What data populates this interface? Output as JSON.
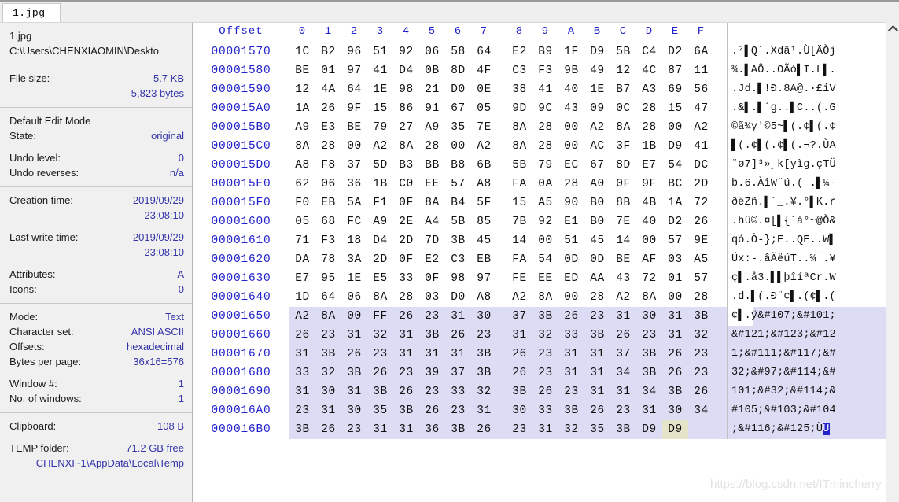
{
  "tab": {
    "label": "1.jpg"
  },
  "sidebar": {
    "file": {
      "name": "1.jpg",
      "path": "C:\\Users\\CHENXIAOMIN\\Deskto"
    },
    "filesize": {
      "label": "File size:",
      "value": "5.7 KB",
      "bytes": "5,823 bytes"
    },
    "edit_mode": {
      "heading": "Default Edit Mode",
      "state_label": "State:",
      "state_value": "original",
      "undo_level_label": "Undo level:",
      "undo_level_value": "0",
      "undo_reverses_label": "Undo reverses:",
      "undo_reverses_value": "n/a"
    },
    "times": {
      "creation_label": "Creation time:",
      "creation_date": "2019/09/29",
      "creation_time": "23:08:10",
      "lastwrite_label": "Last write time:",
      "lastwrite_date": "2019/09/29",
      "lastwrite_time": "23:08:10",
      "attributes_label": "Attributes:",
      "attributes_value": "A",
      "icons_label": "Icons:",
      "icons_value": "0"
    },
    "view": {
      "mode_label": "Mode:",
      "mode_value": "Text",
      "charset_label": "Character set:",
      "charset_value": "ANSI ASCII",
      "offsets_label": "Offsets:",
      "offsets_value": "hexadecimal",
      "bpp_label": "Bytes per page:",
      "bpp_value": "36x16=576",
      "window_label": "Window #:",
      "window_value": "1",
      "numwindows_label": "No. of windows:",
      "numwindows_value": "1"
    },
    "misc": {
      "clipboard_label": "Clipboard:",
      "clipboard_value": "108 B",
      "temp_label": "TEMP folder:",
      "temp_value": "71.2 GB free",
      "temp_path": "CHENXI~1\\AppData\\Local\\Temp"
    }
  },
  "hex": {
    "offset_header": "Offset",
    "column_headers": [
      "0",
      "1",
      "2",
      "3",
      "4",
      "5",
      "6",
      "7",
      "8",
      "9",
      "A",
      "B",
      "C",
      "D",
      "E",
      "F"
    ],
    "rows": [
      {
        "offset": "00001570",
        "bytes": [
          "1C",
          "B2",
          "96",
          "51",
          "92",
          "06",
          "58",
          "64",
          "E2",
          "B9",
          "1F",
          "D9",
          "5B",
          "C4",
          "D2",
          "6A"
        ],
        "ascii": ".²▌Q´.Xdâ¹.Ù[ÄÒj",
        "selected": false
      },
      {
        "offset": "00001580",
        "bytes": [
          "BE",
          "01",
          "97",
          "41",
          "D4",
          "0B",
          "8D",
          "4F",
          "C3",
          "F3",
          "9B",
          "49",
          "12",
          "4C",
          "87",
          "11"
        ],
        "ascii": "¾.▌AÔ..OÃó▌I.L▌.",
        "selected": false
      },
      {
        "offset": "00001590",
        "bytes": [
          "12",
          "4A",
          "64",
          "1E",
          "98",
          "21",
          "D0",
          "0E",
          "38",
          "41",
          "40",
          "1E",
          "B7",
          "A3",
          "69",
          "56"
        ],
        "ascii": ".Jd.▌!Ð.8A@.·£iV",
        "selected": false
      },
      {
        "offset": "000015A0",
        "bytes": [
          "1A",
          "26",
          "9F",
          "15",
          "86",
          "91",
          "67",
          "05",
          "9D",
          "9C",
          "43",
          "09",
          "0C",
          "28",
          "15",
          "47"
        ],
        "ascii": ".&▌.▌´g..▌C..(.G",
        "selected": false
      },
      {
        "offset": "000015B0",
        "bytes": [
          "A9",
          "E3",
          "BE",
          "79",
          "27",
          "A9",
          "35",
          "7E",
          "8A",
          "28",
          "00",
          "A2",
          "8A",
          "28",
          "00",
          "A2"
        ],
        "ascii": "©ã¾y'©5~▌(.¢▌(.¢",
        "selected": false
      },
      {
        "offset": "000015C0",
        "bytes": [
          "8A",
          "28",
          "00",
          "A2",
          "8A",
          "28",
          "00",
          "A2",
          "8A",
          "28",
          "00",
          "AC",
          "3F",
          "1B",
          "D9",
          "41"
        ],
        "ascii": "▌(.¢▌(.¢▌(.¬?.ÙA",
        "selected": false
      },
      {
        "offset": "000015D0",
        "bytes": [
          "A8",
          "F8",
          "37",
          "5D",
          "B3",
          "BB",
          "B8",
          "6B",
          "5B",
          "79",
          "EC",
          "67",
          "8D",
          "E7",
          "54",
          "DC"
        ],
        "ascii": "¨ø7]³»¸k[yìg.çTÜ",
        "selected": false
      },
      {
        "offset": "000015E0",
        "bytes": [
          "62",
          "06",
          "36",
          "1B",
          "C0",
          "EE",
          "57",
          "A8",
          "FA",
          "0A",
          "28",
          "A0",
          "0F",
          "9F",
          "BC",
          "2D"
        ],
        "ascii": "b.6.ÀîW¨ú.( .▌¼-",
        "selected": false
      },
      {
        "offset": "000015F0",
        "bytes": [
          "F0",
          "EB",
          "5A",
          "F1",
          "0F",
          "8A",
          "B4",
          "5F",
          "15",
          "A5",
          "90",
          "B0",
          "8B",
          "4B",
          "1A",
          "72"
        ],
        "ascii": "ðëZñ.▌´_.¥.°▌K.r",
        "selected": false
      },
      {
        "offset": "00001600",
        "bytes": [
          "05",
          "68",
          "FC",
          "A9",
          "2E",
          "A4",
          "5B",
          "85",
          "7B",
          "92",
          "E1",
          "B0",
          "7E",
          "40",
          "D2",
          "26"
        ],
        "ascii": ".hü©.¤[▌{´á°~@Ò&",
        "selected": false
      },
      {
        "offset": "00001610",
        "bytes": [
          "71",
          "F3",
          "18",
          "D4",
          "2D",
          "7D",
          "3B",
          "45",
          "14",
          "00",
          "51",
          "45",
          "14",
          "00",
          "57",
          "9E"
        ],
        "ascii": "qó.Ô-};E..QE..W▌",
        "selected": false
      },
      {
        "offset": "00001620",
        "bytes": [
          "DA",
          "78",
          "3A",
          "2D",
          "0F",
          "E2",
          "C3",
          "EB",
          "FA",
          "54",
          "0D",
          "0D",
          "BE",
          "AF",
          "03",
          "A5"
        ],
        "ascii": "Úx:-.âÃëúT..¾¯.¥",
        "selected": false
      },
      {
        "offset": "00001630",
        "bytes": [
          "E7",
          "95",
          "1E",
          "E5",
          "33",
          "0F",
          "98",
          "97",
          "FE",
          "EE",
          "ED",
          "AA",
          "43",
          "72",
          "01",
          "57"
        ],
        "ascii": "ç▌.å3.▌▌þîíªCr.W",
        "selected": false
      },
      {
        "offset": "00001640",
        "bytes": [
          "1D",
          "64",
          "06",
          "8A",
          "28",
          "03",
          "D0",
          "A8",
          "A2",
          "8A",
          "00",
          "28",
          "A2",
          "8A",
          "00",
          "28"
        ],
        "ascii": ".d.▌(.Ð¨¢▌.(¢▌.(",
        "selected": false
      },
      {
        "offset": "00001650",
        "bytes": [
          "A2",
          "8A",
          "00",
          "FF",
          "26",
          "23",
          "31",
          "30",
          "37",
          "3B",
          "26",
          "23",
          "31",
          "30",
          "31",
          "3B"
        ],
        "ascii": "¢▌.ÿ&#107;&#101;",
        "selected": true,
        "sel_start": 3
      },
      {
        "offset": "00001660",
        "bytes": [
          "26",
          "23",
          "31",
          "32",
          "31",
          "3B",
          "26",
          "23",
          "31",
          "32",
          "33",
          "3B",
          "26",
          "23",
          "31",
          "32"
        ],
        "ascii": "&#121;&#123;&#12",
        "selected": true
      },
      {
        "offset": "00001670",
        "bytes": [
          "31",
          "3B",
          "26",
          "23",
          "31",
          "31",
          "31",
          "3B",
          "26",
          "23",
          "31",
          "31",
          "37",
          "3B",
          "26",
          "23"
        ],
        "ascii": "1;&#111;&#117;&#",
        "selected": true
      },
      {
        "offset": "00001680",
        "bytes": [
          "33",
          "32",
          "3B",
          "26",
          "23",
          "39",
          "37",
          "3B",
          "26",
          "23",
          "31",
          "31",
          "34",
          "3B",
          "26",
          "23"
        ],
        "ascii": "32;&#97;&#114;&#",
        "selected": true
      },
      {
        "offset": "00001690",
        "bytes": [
          "31",
          "30",
          "31",
          "3B",
          "26",
          "23",
          "33",
          "32",
          "3B",
          "26",
          "23",
          "31",
          "31",
          "34",
          "3B",
          "26"
        ],
        "ascii": "101;&#32;&#114;&",
        "selected": true
      },
      {
        "offset": "000016A0",
        "bytes": [
          "23",
          "31",
          "30",
          "35",
          "3B",
          "26",
          "23",
          "31",
          "30",
          "33",
          "3B",
          "26",
          "23",
          "31",
          "30",
          "34"
        ],
        "ascii": "#105;&#103;&#104",
        "selected": true
      },
      {
        "offset": "000016B0",
        "bytes": [
          "3B",
          "26",
          "23",
          "31",
          "31",
          "36",
          "3B",
          "26",
          "23",
          "31",
          "32",
          "35",
          "3B",
          "D9",
          "D9",
          ""
        ],
        "ascii": ";&#116;&#125;ÙÙ",
        "selected": true,
        "caret_index": 14,
        "caret_ascii_index": 14
      }
    ]
  },
  "scrollbar": {
    "up_icon": "chevron-up-icon"
  },
  "watermark": {
    "text": "https://blog.csdn.net/ITmincherry"
  }
}
